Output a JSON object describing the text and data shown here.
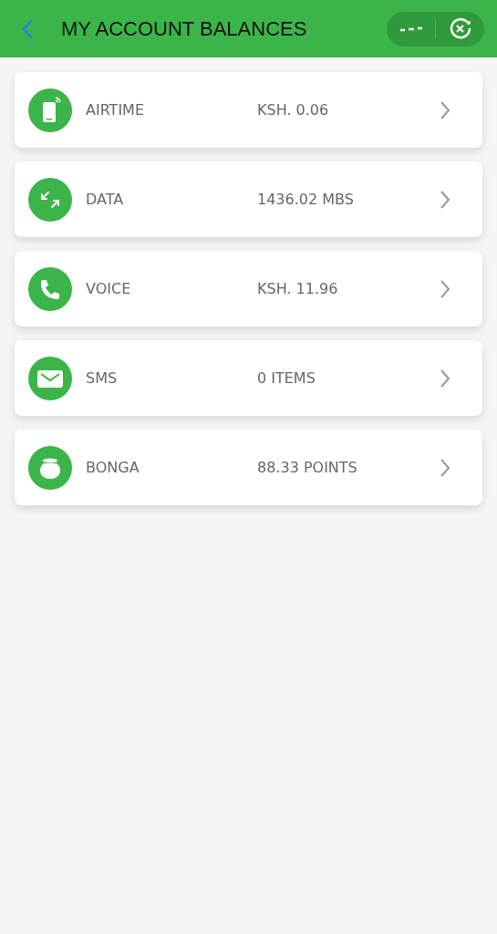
{
  "header": {
    "title": "MY ACCOUNT BALANCES"
  },
  "balances": [
    {
      "kind": "airtime",
      "label": "AIRTIME",
      "value": "KSH. 0.06"
    },
    {
      "kind": "data",
      "label": "DATA",
      "value": "1436.02 MBS"
    },
    {
      "kind": "voice",
      "label": "VOICE",
      "value": "KSH. 11.96"
    },
    {
      "kind": "sms",
      "label": "SMS",
      "value": "0 ITEMS"
    },
    {
      "kind": "bonga",
      "label": "BONGA",
      "value": "88.33 POINTS"
    }
  ]
}
